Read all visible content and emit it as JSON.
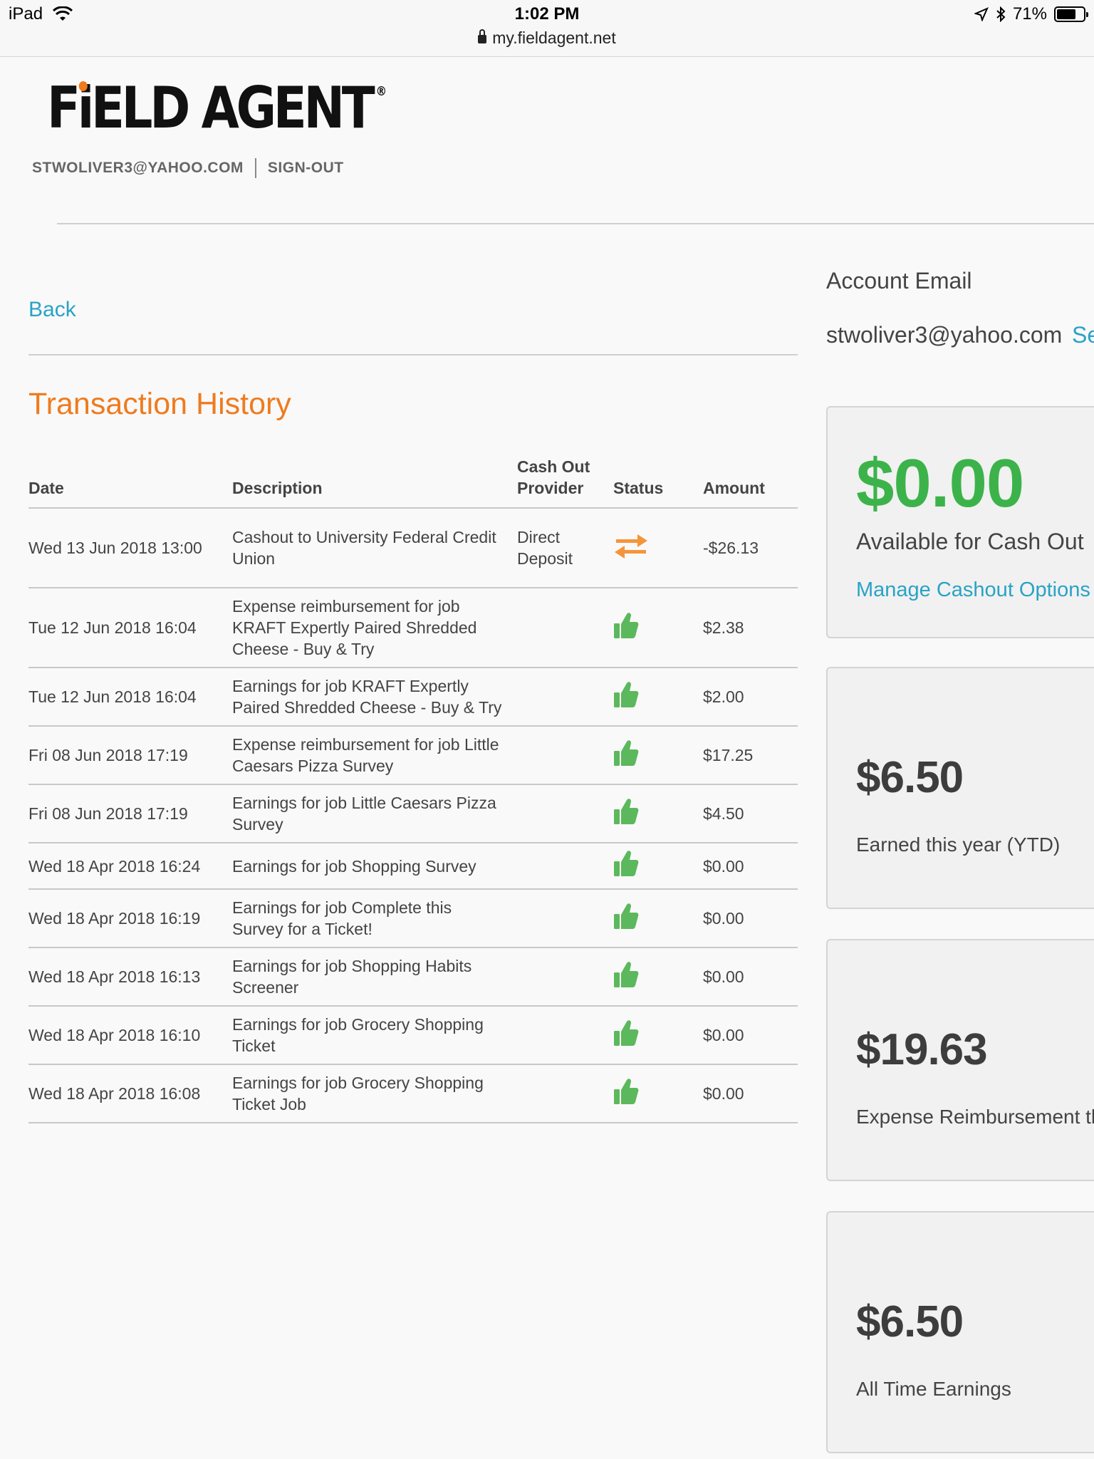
{
  "status_bar": {
    "device": "iPad",
    "time": "1:02 PM",
    "url": "my.fieldagent.net",
    "battery": "71%",
    "battery_level": 0.71
  },
  "header": {
    "logo_text": "FiELD AGENT",
    "user_email": "STWOLIVER3@YAHOO.COM",
    "sign_out": "SIGN-OUT"
  },
  "nav": {
    "back_label": "Back"
  },
  "transactions": {
    "title": "Transaction History",
    "columns": [
      "Date",
      "Description",
      "Cash Out Provider",
      "Status",
      "Amount"
    ],
    "rows": [
      {
        "date": "Wed 13 Jun 2018 13:00",
        "description": "Cashout to University Federal Credit Union",
        "provider": "Direct Deposit",
        "status": "transfer-icon",
        "amount": "-$26.13"
      },
      {
        "date": "Tue 12 Jun 2018 16:04",
        "description": "Expense reimbursement for job KRAFT Expertly Paired Shredded Cheese - Buy & Try",
        "provider": "",
        "status": "thumbs-up-icon",
        "amount": "$2.38"
      },
      {
        "date": "Tue 12 Jun 2018 16:04",
        "description": "Earnings for job KRAFT Expertly Paired Shredded Cheese - Buy & Try",
        "provider": "",
        "status": "thumbs-up-icon",
        "amount": "$2.00"
      },
      {
        "date": "Fri 08 Jun 2018 17:19",
        "description": "Expense reimbursement for job Little Caesars Pizza Survey",
        "provider": "",
        "status": "thumbs-up-icon",
        "amount": "$17.25"
      },
      {
        "date": "Fri 08 Jun 2018 17:19",
        "description": "Earnings for job Little Caesars Pizza Survey",
        "provider": "",
        "status": "thumbs-up-icon",
        "amount": "$4.50"
      },
      {
        "date": "Wed 18 Apr 2018 16:24",
        "description": "Earnings for job Shopping Survey",
        "provider": "",
        "status": "thumbs-up-icon",
        "amount": "$0.00"
      },
      {
        "date": "Wed 18 Apr 2018 16:19",
        "description": "Earnings for job Complete this Survey for a Ticket!",
        "provider": "",
        "status": "thumbs-up-icon",
        "amount": "$0.00"
      },
      {
        "date": "Wed 18 Apr 2018 16:13",
        "description": "Earnings for job Shopping Habits Screener",
        "provider": "",
        "status": "thumbs-up-icon",
        "amount": "$0.00"
      },
      {
        "date": "Wed 18 Apr 2018 16:10",
        "description": "Earnings for job Grocery Shopping Ticket",
        "provider": "",
        "status": "thumbs-up-icon",
        "amount": "$0.00"
      },
      {
        "date": "Wed 18 Apr 2018 16:08",
        "description": "Earnings for job Grocery Shopping Ticket Job",
        "provider": "",
        "status": "thumbs-up-icon",
        "amount": "$0.00"
      }
    ]
  },
  "account": {
    "email_label": "Account Email",
    "email_value": "stwoliver3@yahoo.com",
    "email_link": "Se"
  },
  "summary_cards": [
    {
      "amount": "$0.00",
      "caption": "Available for Cash Out",
      "link": "Manage Cashout Options",
      "amount_color": "#3cb34a"
    },
    {
      "amount": "$6.50",
      "caption": "Earned this year (YTD)"
    },
    {
      "amount": "$19.63",
      "caption": "Expense Reimbursement th"
    },
    {
      "amount": "$6.50",
      "caption": "All Time Earnings"
    }
  ],
  "colors": {
    "accent_orange": "#ef7b1e",
    "link_blue": "#29a3c6",
    "success_green": "#3cb34a",
    "thumb_green": "#5cb85c",
    "transfer_orange": "#f5953a"
  }
}
